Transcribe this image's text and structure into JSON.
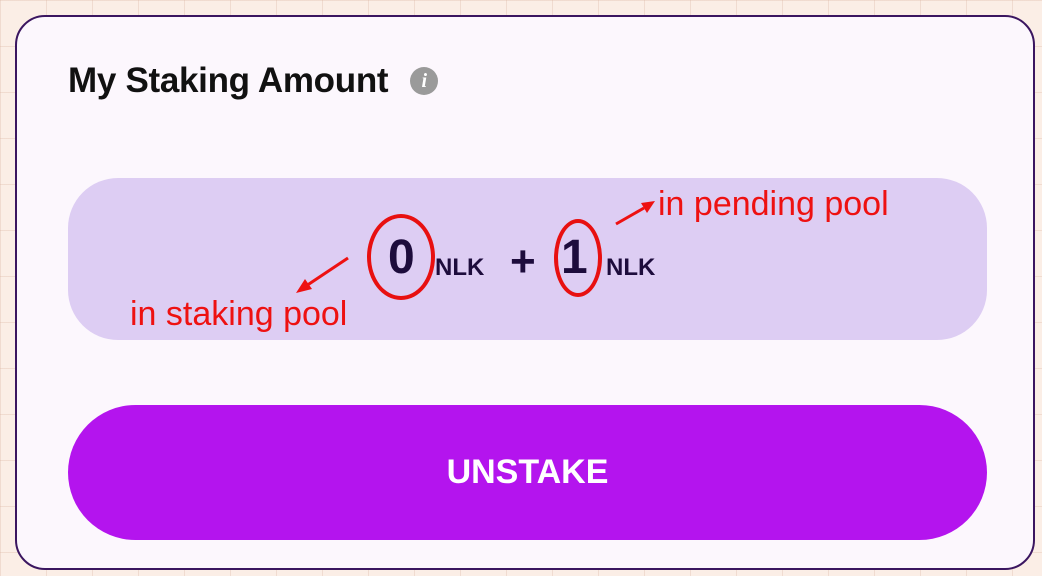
{
  "card": {
    "title": "My Staking Amount",
    "info_icon": "info-icon"
  },
  "staking": {
    "staking_pool_value": "0",
    "staking_pool_unit": "NLK",
    "plus_sign": "+",
    "pending_pool_value": "1",
    "pending_pool_unit": "NLK"
  },
  "annotations": {
    "staking_pool_label": "in staking pool",
    "pending_pool_label": "in pending pool",
    "color": "#ee1111"
  },
  "actions": {
    "unstake_label": "UNSTAKE"
  },
  "colors": {
    "accent": "#b414ee",
    "amount_box": "#ddcdf3",
    "card_border": "#3b1660"
  }
}
